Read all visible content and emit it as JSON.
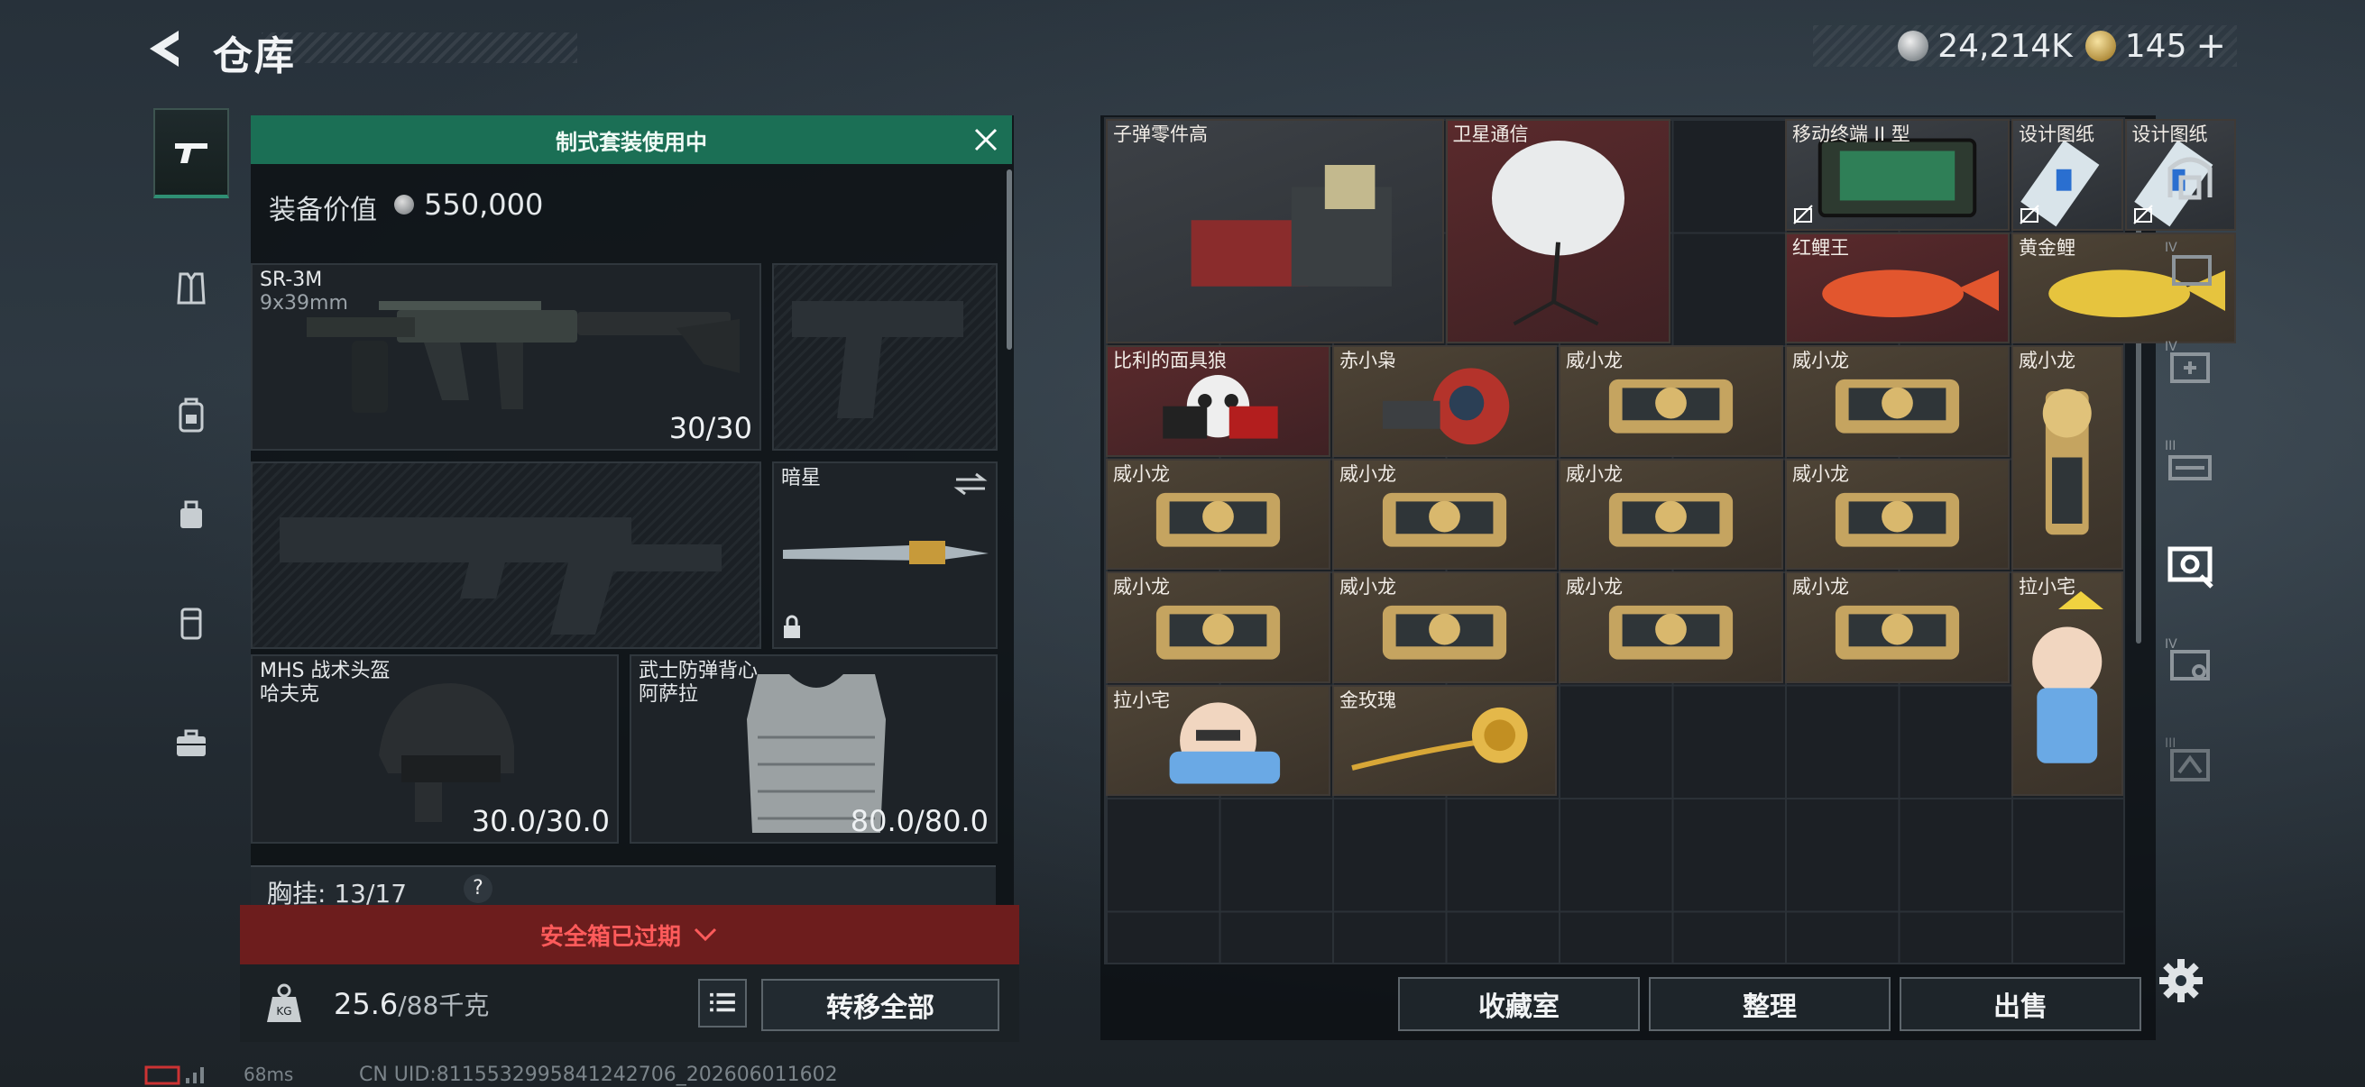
{
  "header": {
    "title": "仓库"
  },
  "currency": {
    "silver": "24,214K",
    "gold": "145",
    "gold_plus": "+"
  },
  "left_tabs": [
    {
      "icon": "pistol-icon",
      "active": true
    },
    {
      "icon": "armor-icon"
    },
    {
      "icon": "backpack-icon"
    },
    {
      "icon": "pouch-icon"
    },
    {
      "icon": "case-icon"
    },
    {
      "icon": "briefcase-icon"
    }
  ],
  "loadout": {
    "kit_banner": "制式套装使用中",
    "value_label": "装备价值",
    "value_amount": "550,000",
    "primary": {
      "name": "SR-3M",
      "caliber": "9x39mm",
      "ammo": "30/30"
    },
    "melee": {
      "name": "暗星"
    },
    "helmet": {
      "name": "MHS 战术头盔",
      "sub": "哈夫克",
      "durability": "30.0/30.0"
    },
    "vest": {
      "name": "武士防弹背心",
      "sub": "阿萨拉",
      "durability": "80.0/80.0"
    },
    "chest_rig": {
      "label": "胸挂:",
      "value": "13/17",
      "help": "?"
    },
    "safebox": "安全箱已过期",
    "weight": {
      "current": "25.6",
      "max": "/88千克"
    },
    "transfer_all": "转移全部"
  },
  "storage": {
    "items": [
      {
        "name": "子弹零件高",
        "bg": "gray"
      },
      {
        "name": "卫星通信",
        "bg": "red"
      },
      {
        "name": "移动终端 II 型",
        "bg": "gray"
      },
      {
        "name": "设计图纸",
        "bg": "gray"
      },
      {
        "name": "设计图纸",
        "bg": "gray"
      },
      {
        "name": "红鲤王",
        "bg": "red"
      },
      {
        "name": "黄金鲤",
        "bg": "gold"
      },
      {
        "name": "比利的面具狼",
        "bg": "red"
      },
      {
        "name": "赤小枭",
        "bg": "gold"
      },
      {
        "name": "威小龙",
        "bg": "gold"
      },
      {
        "name": "威小龙",
        "bg": "gold"
      },
      {
        "name": "威小龙",
        "bg": "gold"
      },
      {
        "name": "威小龙",
        "bg": "gold"
      },
      {
        "name": "威小龙",
        "bg": "gold"
      },
      {
        "name": "威小龙",
        "bg": "gold"
      },
      {
        "name": "威小龙",
        "bg": "gold"
      },
      {
        "name": "威小龙",
        "bg": "gold"
      },
      {
        "name": "威小龙",
        "bg": "gold"
      },
      {
        "name": "威小龙",
        "bg": "gold"
      },
      {
        "name": "威小龙",
        "bg": "gold"
      },
      {
        "name": "拉小宅",
        "bg": "gold"
      },
      {
        "name": "拉小宅",
        "bg": "gold"
      },
      {
        "name": "金玫瑰",
        "bg": "gold"
      }
    ],
    "actions": {
      "collection": "收藏室",
      "sort": "整理",
      "sell": "出售"
    }
  },
  "footer": {
    "ping": "68ms",
    "uid": "CN UID:8115532995841242706_202606011602"
  },
  "colors": {
    "accent_green": "#1b6f55",
    "danger_red": "#6d1d1d",
    "danger_text": "#ff5b5b"
  }
}
